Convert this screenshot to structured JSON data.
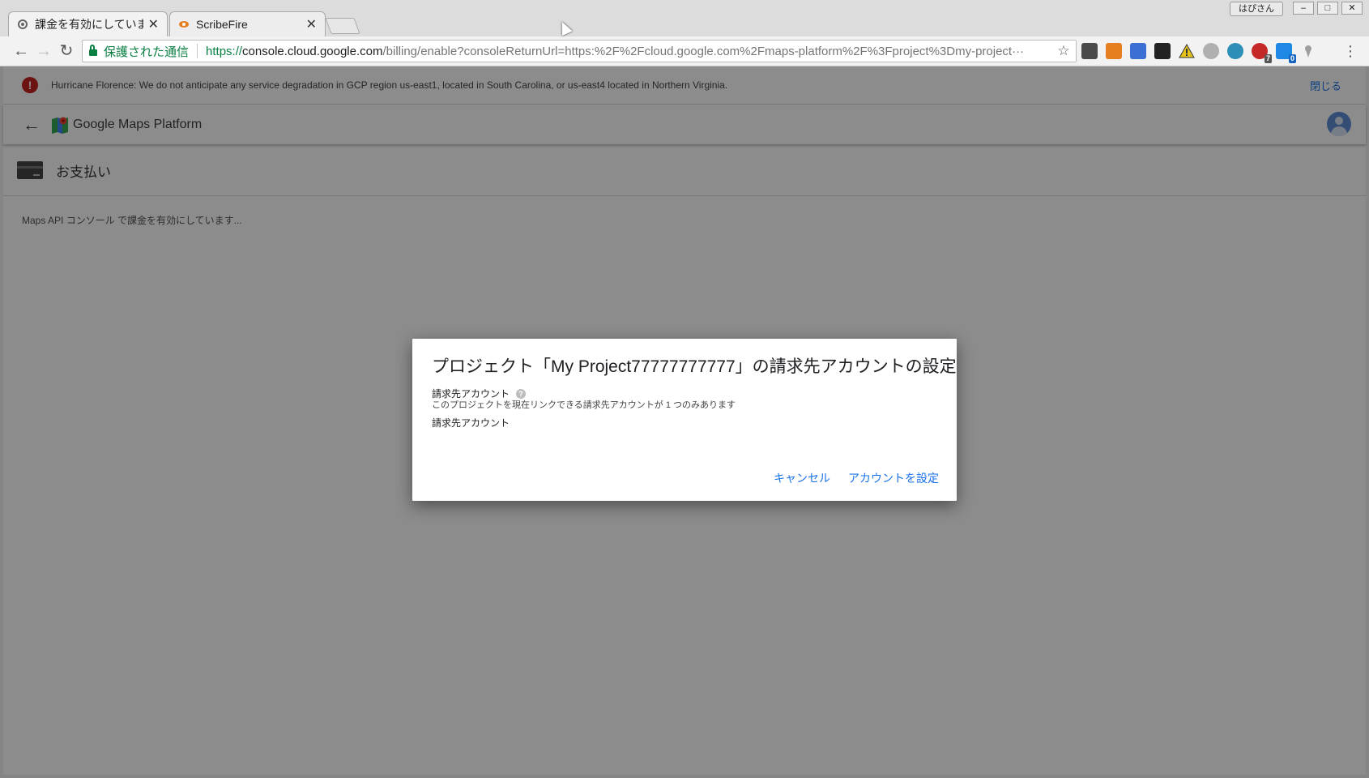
{
  "window": {
    "profile_name": "はぴさん",
    "controls": {
      "minimize": "–",
      "maximize": "□",
      "close": "✕"
    }
  },
  "tabs": [
    {
      "title": "課金を有効にしています",
      "close": "✕",
      "active": true,
      "icon": "gear-icon"
    },
    {
      "title": "ScribeFire",
      "close": "✕",
      "active": false,
      "icon": "scribefire-icon"
    }
  ],
  "toolbar": {
    "back": "←",
    "forward": "→",
    "reload": "↻",
    "secure_label": "保護された通信",
    "url_scheme": "https://",
    "url_host": "console.cloud.google.com",
    "url_rest": "/billing/enable?consoleReturnUrl=https:%2F%2Fcloud.google.com%2Fmaps-platform%2F%3Fproject%3Dmy-project···",
    "star": "☆",
    "menu": "⋮",
    "extensions": [
      {
        "name": "pocket-icon",
        "color": "#4a4a4a"
      },
      {
        "name": "scribefire-ext-icon",
        "color": "#e67e22"
      },
      {
        "name": "analytics-icon",
        "color": "#3b6fd4"
      },
      {
        "name": "buffer-icon",
        "color": "#222222"
      },
      {
        "name": "warning-icon",
        "color": "#e6c31a"
      },
      {
        "name": "cloud-icon",
        "color": "#b0b0b0"
      },
      {
        "name": "m-ext-icon",
        "color": "#2d8fb8"
      },
      {
        "name": "r-ext-icon",
        "color": "#c62828",
        "badge": "7"
      },
      {
        "name": "blue-ext-icon",
        "color": "#1e88e5",
        "badge": "0"
      },
      {
        "name": "pin-icon",
        "color": "#9e9e9e"
      }
    ]
  },
  "banner": {
    "text": "Hurricane Florence: We do not anticipate any service degradation in GCP region us-east1, located in South Carolina, or us-east4 located in Northern Virginia.",
    "close_label": "閉じる"
  },
  "appbar": {
    "back": "←",
    "title": "Google Maps Platform"
  },
  "section": {
    "title": "お支払い"
  },
  "status_text": "Maps API コンソール で課金を有効にしています...",
  "dialog": {
    "title": "プロジェクト「My Project77777777777」の請求先アカウントの設定",
    "label": "請求先アカウント",
    "help": "?",
    "description": "このプロジェクトを現在リンクできる請求先アカウントが 1 つのみあります",
    "label2": "請求先アカウント",
    "cancel": "キャンセル",
    "confirm": "アカウントを設定"
  }
}
